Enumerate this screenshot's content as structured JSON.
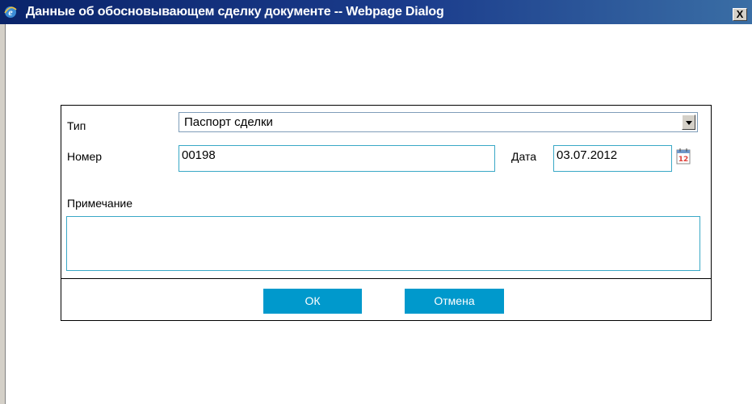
{
  "window": {
    "title": "Данные об обосновывающем сделку документе -- Webpage Dialog",
    "close_label": "X",
    "icon": "ie-icon"
  },
  "form": {
    "type_label": "Тип",
    "type_value": "Паспорт сделки",
    "number_label": "Номер",
    "number_value": "00198",
    "date_label": "Дата",
    "date_value": "03.07.2012",
    "calendar_day": "12",
    "note_label": "Примечание",
    "note_value": ""
  },
  "buttons": {
    "ok": "ОК",
    "cancel": "Отмена"
  },
  "colors": {
    "titlebar": "#0a246a",
    "button": "#0099cc",
    "input_border": "#39a8c6"
  }
}
